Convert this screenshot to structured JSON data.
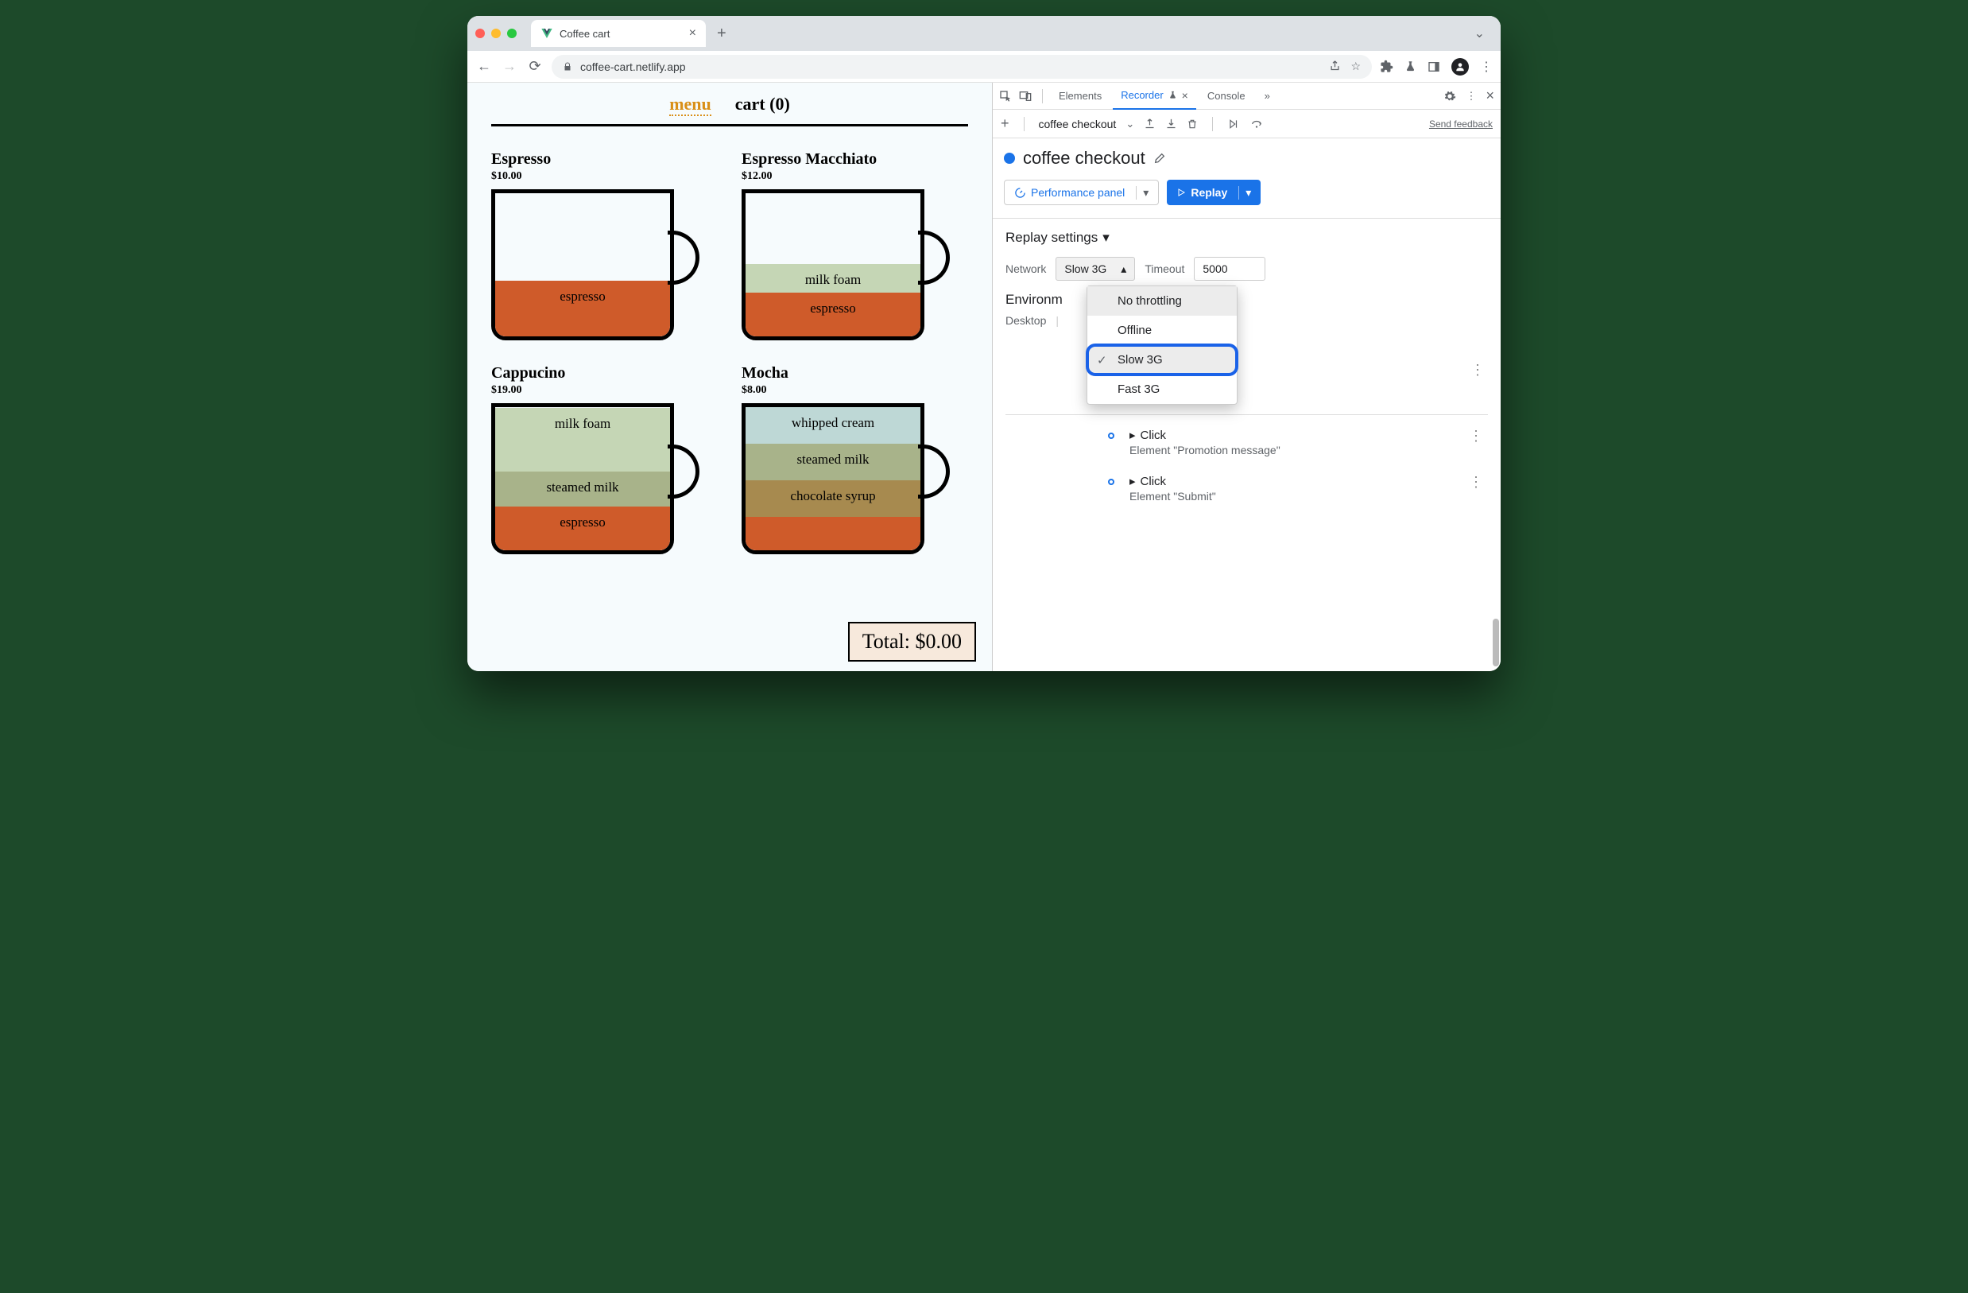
{
  "browser": {
    "tab_title": "Coffee cart",
    "url": "coffee-cart.netlify.app"
  },
  "page": {
    "nav": {
      "menu": "menu",
      "cart": "cart (0)"
    },
    "products": [
      {
        "name": "Espresso",
        "price": "$10.00",
        "layers": [
          "espresso"
        ]
      },
      {
        "name": "Espresso Macchiato",
        "price": "$12.00",
        "layers": [
          "milk foam",
          "espresso"
        ]
      },
      {
        "name": "Cappucino",
        "price": "$19.00",
        "layers": [
          "milk foam",
          "steamed milk",
          "espresso"
        ]
      },
      {
        "name": "Mocha",
        "price": "$8.00",
        "layers": [
          "whipped cream",
          "steamed milk",
          "chocolate syrup"
        ],
        "extra_bottom": true
      }
    ],
    "total_label": "Total: $0.00"
  },
  "devtools": {
    "tabs": {
      "elements": "Elements",
      "recorder": "Recorder",
      "console": "Console"
    },
    "toolbar": {
      "recording_name": "coffee checkout",
      "feedback": "Send feedback"
    },
    "header": {
      "title": "coffee checkout",
      "perf_btn": "Performance panel",
      "replay_btn": "Replay"
    },
    "replay_settings": {
      "title": "Replay settings",
      "network_label": "Network",
      "network_value": "Slow 3G",
      "timeout_label": "Timeout",
      "timeout_value": "5000",
      "env_label_trunc": "Environm",
      "desktop_label": "Desktop"
    },
    "dropdown": {
      "no_throttling": "No throttling",
      "offline": "Offline",
      "slow3g": "Slow 3G",
      "fast3g": "Fast 3G"
    },
    "steps": [
      {
        "title": "Click",
        "sub": "Element \"Promotion message\""
      },
      {
        "title": "Click",
        "sub": "Element \"Submit\""
      }
    ]
  }
}
